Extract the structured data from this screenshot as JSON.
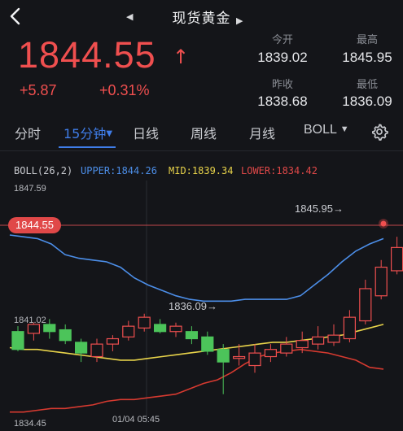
{
  "header": {
    "title": "现货黄金",
    "back_icon": "chevron-left-icon",
    "prev_icon": "triangle-left-icon",
    "next_icon": "triangle-right-icon"
  },
  "quote": {
    "price": "1844.55",
    "direction_icon": "arrow-up-icon",
    "change": "+5.87",
    "change_pct": "+0.31%",
    "stats": [
      {
        "label": "今开",
        "value": "1839.02"
      },
      {
        "label": "最高",
        "value": "1845.95"
      },
      {
        "label": "昨收",
        "value": "1838.68"
      },
      {
        "label": "最低",
        "value": "1836.09"
      }
    ]
  },
  "tabs": {
    "items": [
      "分时",
      "15分钟",
      "日线",
      "周线",
      "月线",
      "BOLL"
    ],
    "active": "15分钟",
    "settings_icon": "gear-icon"
  },
  "indicator": {
    "name": "BOLL(26,2)",
    "upper": "UPPER:1844.26",
    "mid": "MID:1839.34",
    "lower": "LOWER:1834.42"
  },
  "colors": {
    "up": "#ef4f4f",
    "down": "#4cc45a",
    "upper": "#4c8ee8",
    "mid": "#e8d34a",
    "lower": "#d63a30",
    "accent": "#3f7de8"
  },
  "chart": {
    "axis": {
      "top": "1847.59",
      "middle": "1841.02",
      "bottom": "1834.45"
    },
    "time_label": "01/04 05:45",
    "current_price_tag": "1844.55",
    "high_annotation": "1845.95→",
    "low_annotation": "1836.09→"
  },
  "chart_data": {
    "type": "line",
    "ylim": [
      1834.45,
      1847.59
    ],
    "candles": [
      {
        "o": 1839.6,
        "c": 1838.6,
        "h": 1839.9,
        "l": 1838.5
      },
      {
        "o": 1839.5,
        "c": 1840.0,
        "h": 1840.1,
        "l": 1839.1
      },
      {
        "o": 1840.0,
        "c": 1839.6,
        "h": 1840.3,
        "l": 1839.2
      },
      {
        "o": 1839.7,
        "c": 1839.1,
        "h": 1840.0,
        "l": 1838.9
      },
      {
        "o": 1839.0,
        "c": 1838.4,
        "h": 1839.2,
        "l": 1837.9
      },
      {
        "o": 1838.2,
        "c": 1838.9,
        "h": 1839.2,
        "l": 1837.9
      },
      {
        "o": 1838.9,
        "c": 1839.2,
        "h": 1839.4,
        "l": 1838.5
      },
      {
        "o": 1839.3,
        "c": 1839.9,
        "h": 1840.2,
        "l": 1839.1
      },
      {
        "o": 1839.8,
        "c": 1840.4,
        "h": 1840.6,
        "l": 1839.6
      },
      {
        "o": 1840.0,
        "c": 1839.6,
        "h": 1840.3,
        "l": 1839.5
      },
      {
        "o": 1839.6,
        "c": 1839.9,
        "h": 1840.1,
        "l": 1839.3
      },
      {
        "o": 1839.6,
        "c": 1839.2,
        "h": 1839.9,
        "l": 1838.9
      },
      {
        "o": 1839.3,
        "c": 1838.5,
        "h": 1839.6,
        "l": 1838.3
      },
      {
        "o": 1838.6,
        "c": 1837.9,
        "h": 1838.9,
        "l": 1836.1
      },
      {
        "o": 1838.1,
        "c": 1838.2,
        "h": 1838.9,
        "l": 1837.7
      },
      {
        "o": 1837.7,
        "c": 1838.4,
        "h": 1838.9,
        "l": 1837.3
      },
      {
        "o": 1838.2,
        "c": 1838.6,
        "h": 1838.9,
        "l": 1837.9
      },
      {
        "o": 1838.4,
        "c": 1838.9,
        "h": 1839.3,
        "l": 1838.2
      },
      {
        "o": 1838.7,
        "c": 1839.1,
        "h": 1839.6,
        "l": 1838.4
      },
      {
        "o": 1838.9,
        "c": 1839.3,
        "h": 1839.9,
        "l": 1838.6
      },
      {
        "o": 1839.0,
        "c": 1839.4,
        "h": 1840.0,
        "l": 1838.8
      },
      {
        "o": 1839.2,
        "c": 1840.4,
        "h": 1840.8,
        "l": 1839.0
      },
      {
        "o": 1840.2,
        "c": 1842.0,
        "h": 1842.5,
        "l": 1840.0
      },
      {
        "o": 1841.6,
        "c": 1843.2,
        "h": 1843.6,
        "l": 1841.4
      },
      {
        "o": 1843.0,
        "c": 1844.3,
        "h": 1844.9,
        "l": 1842.8
      },
      {
        "o": 1844.2,
        "c": 1845.2,
        "h": 1845.95,
        "l": 1843.9
      },
      {
        "o": 1845.1,
        "c": 1844.6,
        "h": 1845.3,
        "l": 1844.2
      },
      {
        "o": 1844.5,
        "c": 1844.6,
        "h": 1845.0,
        "l": 1844.3
      }
    ],
    "upper": [
      1845.0,
      1844.9,
      1844.8,
      1844.5,
      1843.9,
      1843.7,
      1843.6,
      1843.5,
      1843.2,
      1842.6,
      1842.2,
      1841.9,
      1841.6,
      1841.4,
      1841.3,
      1841.3,
      1841.3,
      1841.4,
      1841.4,
      1841.4,
      1841.4,
      1841.6,
      1842.2,
      1842.8,
      1843.5,
      1844.1,
      1844.5,
      1844.8
    ],
    "mid": [
      1838.7,
      1838.6,
      1838.6,
      1838.5,
      1838.4,
      1838.3,
      1838.2,
      1838.1,
      1838.0,
      1838.0,
      1838.1,
      1838.2,
      1838.3,
      1838.4,
      1838.5,
      1838.6,
      1838.7,
      1838.8,
      1838.9,
      1839.0,
      1839.0,
      1839.1,
      1839.2,
      1839.3,
      1839.4,
      1839.6,
      1839.8,
      1840.0
    ],
    "lower": [
      1835.1,
      1835.1,
      1835.2,
      1835.3,
      1835.3,
      1835.4,
      1835.5,
      1835.7,
      1835.8,
      1835.8,
      1835.9,
      1836.0,
      1836.1,
      1836.4,
      1836.7,
      1836.9,
      1837.3,
      1837.8,
      1838.2,
      1838.4,
      1838.5,
      1838.6,
      1838.5,
      1838.4,
      1838.2,
      1838.0,
      1837.6,
      1837.5
    ]
  }
}
